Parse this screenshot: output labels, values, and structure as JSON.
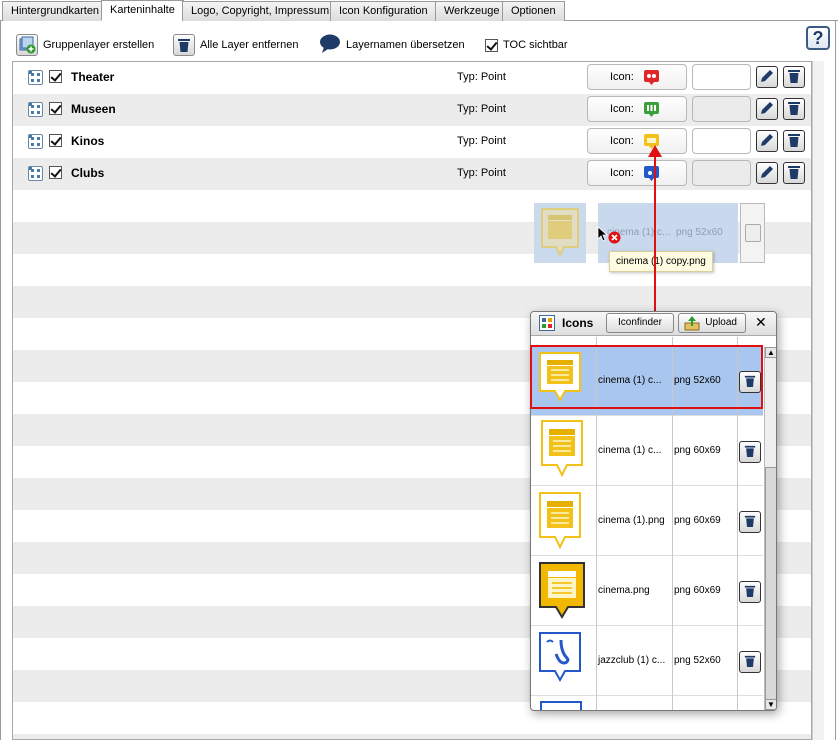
{
  "tabs": [
    {
      "label": "Hintergrundkarten",
      "active": false
    },
    {
      "label": "Karteninhalte",
      "active": true
    },
    {
      "label": "Logo, Copyright, Impressum",
      "active": false
    },
    {
      "label": "Icon Konfiguration",
      "active": false
    },
    {
      "label": "Werkzeuge",
      "active": false
    },
    {
      "label": "Optionen",
      "active": false
    }
  ],
  "toolbar": {
    "add_group": "Gruppenlayer erstellen",
    "remove_all": "Alle Layer entfernen",
    "translate": "Layernamen übersetzen",
    "toc_visible": "TOC sichtbar",
    "help": "?"
  },
  "layers": [
    {
      "name": "Theater",
      "type": "Typ: Point",
      "icon_label": "Icon:",
      "icon_color": "#e0252b"
    },
    {
      "name": "Museen",
      "type": "Typ: Point",
      "icon_label": "Icon:",
      "icon_color": "#3aa13a"
    },
    {
      "name": "Kinos",
      "type": "Typ: Point",
      "icon_label": "Icon:",
      "icon_color": "#f2c21a"
    },
    {
      "name": "Clubs",
      "type": "Typ: Point",
      "icon_label": "Icon:",
      "icon_color": "#2458c8"
    }
  ],
  "drag_ghost": {
    "name": "cinema (1) c...",
    "format": "png 52x60",
    "tooltip": "cinema (1) copy.png"
  },
  "icons_panel": {
    "title": "Icons",
    "iconfinder": "Iconfinder",
    "upload": "Upload",
    "close": "✕",
    "items": [
      {
        "name": "cinema (1) c...",
        "format": "png 52x60",
        "selected": true
      },
      {
        "name": "cinema (1) c...",
        "format": "png 60x69",
        "selected": false
      },
      {
        "name": "cinema (1).png",
        "format": "png 60x69",
        "selected": false
      },
      {
        "name": "cinema.png",
        "format": "png 60x69",
        "selected": false
      },
      {
        "name": "jazzclub (1) c...",
        "format": "png 52x60",
        "selected": false
      }
    ]
  },
  "colors": {
    "selection": "#a9c6ee",
    "highlight": "#e01010",
    "cinema_yellow": "#f2c21a"
  }
}
